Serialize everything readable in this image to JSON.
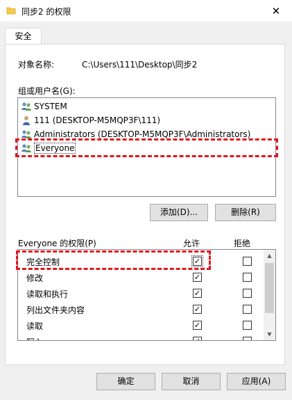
{
  "window": {
    "title": "同步2 的权限",
    "close_glyph": "✕"
  },
  "tabs": [
    {
      "label": "安全",
      "active": true
    }
  ],
  "object": {
    "label": "对象名称:",
    "value": "C:\\Users\\111\\Desktop\\同步2"
  },
  "groups": {
    "label": "组或用户名(G):",
    "items": [
      {
        "label": "SYSTEM",
        "icon": "users-group-icon"
      },
      {
        "label": "111 (DESKTOP-M5MQP3F\\111)",
        "icon": "user-icon"
      },
      {
        "label": "Administrators (DESKTOP-M5MQP3F\\Administrators)",
        "icon": "users-group-icon"
      },
      {
        "label": "Everyone",
        "icon": "users-group-icon",
        "selected": true
      }
    ],
    "add_button": "添加(D)...",
    "remove_button": "删除(R)"
  },
  "permissions": {
    "label": "Everyone 的权限(P)",
    "allow_header": "允许",
    "deny_header": "拒绝",
    "rows": [
      {
        "name": "完全控制",
        "allow": true,
        "deny": false
      },
      {
        "name": "修改",
        "allow": true,
        "deny": false
      },
      {
        "name": "读取和执行",
        "allow": true,
        "deny": false
      },
      {
        "name": "列出文件夹内容",
        "allow": true,
        "deny": false
      },
      {
        "name": "读取",
        "allow": true,
        "deny": false
      },
      {
        "name": "写入",
        "allow": true,
        "deny": false
      }
    ]
  },
  "footer": {
    "ok": "确定",
    "cancel": "取消",
    "apply": "应用(A)"
  },
  "colors": {
    "highlight": "#e0171f",
    "folder": "#f7c94b"
  }
}
